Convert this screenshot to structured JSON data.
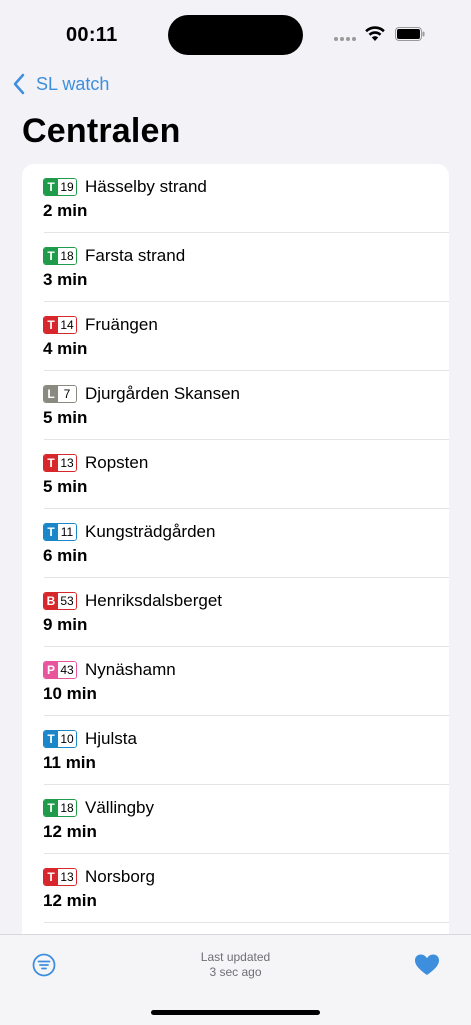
{
  "status": {
    "time": "00:11"
  },
  "nav": {
    "back_label": "SL watch",
    "title": "Centralen"
  },
  "colors": {
    "accent": "#3e8ede",
    "metro_green": "#1f9b4a",
    "metro_red": "#d7262c",
    "metro_blue": "#1b87c9",
    "tram_gray": "#8a8a80",
    "bus_red": "#d7262c",
    "train_pink": "#e8559d"
  },
  "departures": [
    {
      "mode": "T",
      "line": "19",
      "color": "#1f9b4a",
      "destination": "Hässelby strand",
      "time": "2 min"
    },
    {
      "mode": "T",
      "line": "18",
      "color": "#1f9b4a",
      "destination": "Farsta strand",
      "time": "3 min"
    },
    {
      "mode": "T",
      "line": "14",
      "color": "#d7262c",
      "destination": "Fruängen",
      "time": "4 min"
    },
    {
      "mode": "L",
      "line": "7",
      "color": "#8a8a80",
      "destination": "Djurgården Skansen",
      "time": "5 min"
    },
    {
      "mode": "T",
      "line": "13",
      "color": "#d7262c",
      "destination": "Ropsten",
      "time": "5 min"
    },
    {
      "mode": "T",
      "line": "11",
      "color": "#1b87c9",
      "destination": "Kungsträdgården",
      "time": "6 min"
    },
    {
      "mode": "B",
      "line": "53",
      "color": "#d7262c",
      "destination": "Henriksdalsberget",
      "time": "9 min"
    },
    {
      "mode": "P",
      "line": "43",
      "color": "#e8559d",
      "destination": "Nynäshamn",
      "time": "10 min"
    },
    {
      "mode": "T",
      "line": "10",
      "color": "#1b87c9",
      "destination": "Hjulsta",
      "time": "11 min"
    },
    {
      "mode": "T",
      "line": "18",
      "color": "#1f9b4a",
      "destination": "Vällingby",
      "time": "12 min"
    },
    {
      "mode": "T",
      "line": "13",
      "color": "#d7262c",
      "destination": "Norsborg",
      "time": "12 min"
    }
  ],
  "footer": {
    "updated_line1": "Last updated",
    "updated_line2": "3 sec ago"
  },
  "icons": {
    "filter": "filter-list-icon",
    "favorite": "heart-icon",
    "back": "chevron-left-icon"
  }
}
